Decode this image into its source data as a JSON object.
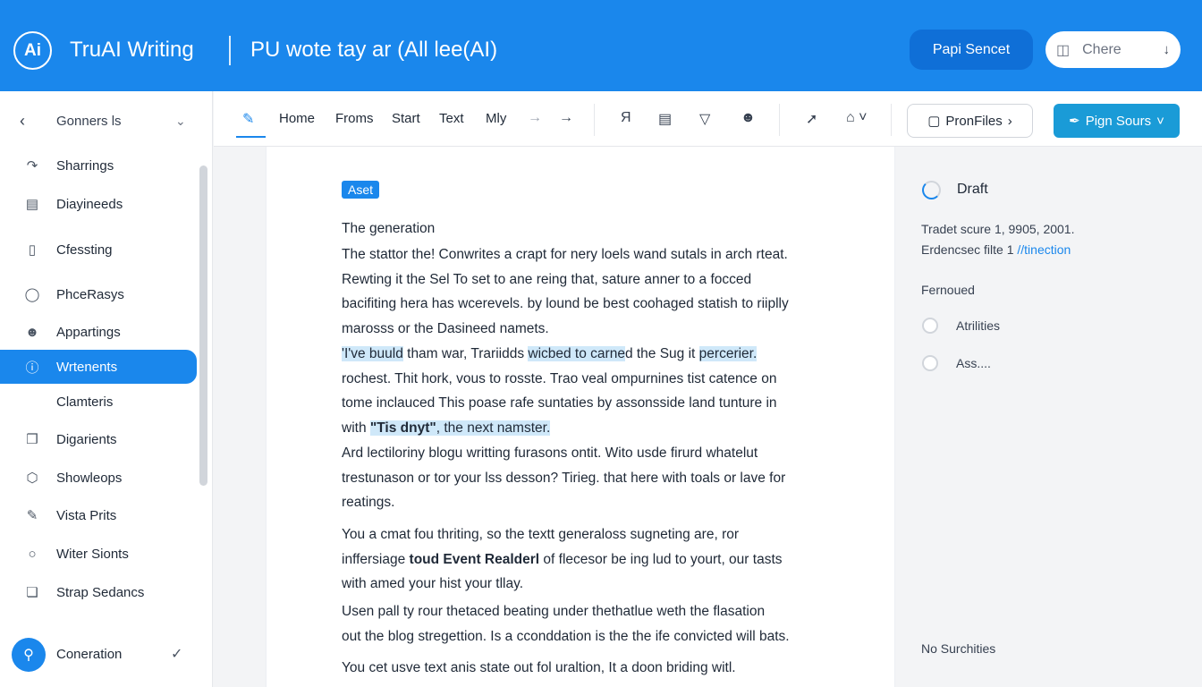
{
  "header": {
    "logo_text": "Ai",
    "app_title": "TruAI Writing",
    "doc_title": "PU wote tay ar (All lee(AI)",
    "primary_button": "Papi Sencet",
    "share_pill_label": "Chere"
  },
  "sidebar": {
    "top_label": "Gonners ls",
    "items": [
      {
        "label": "Sharrings",
        "icon": "share-icon"
      },
      {
        "label": "Diayineeds",
        "icon": "layers-icon"
      },
      {
        "label": "Cfessting",
        "icon": "document-icon"
      },
      {
        "label": "PhceRasys",
        "icon": "globe-icon"
      },
      {
        "label": "Appartings",
        "icon": "user-icon"
      },
      {
        "label": "Wrtenents",
        "icon": "info-icon"
      },
      {
        "label": "Clamteris",
        "icon": ""
      },
      {
        "label": "Digarients",
        "icon": "cube-icon"
      },
      {
        "label": "Showleops",
        "icon": "hexagon-icon"
      },
      {
        "label": "Vista Prits",
        "icon": "pen-icon"
      },
      {
        "label": "Witer Sionts",
        "icon": "chat-icon"
      },
      {
        "label": "Strap Sedancs",
        "icon": "copy-icon"
      }
    ],
    "bottom_label": "Coneration"
  },
  "toolbar": {
    "tabs": [
      "Home",
      "Froms",
      "Start",
      "Text",
      "Mly"
    ],
    "profile_button": "PronFiles",
    "sign_button": "Pign Sours"
  },
  "document": {
    "tag": "Aset",
    "heading": "The generation",
    "paragraphs": [
      [
        "The stattor the! Conwrites a crapt for nery loels wand sutals in arch rteat.",
        "Rewting it the Sel To set to ane reing that, sature anner to a focced",
        "bacifiting hera has wcerevels. by lound be best coohaged statish to riiplly",
        "marosss or the Dasineed namets."
      ],
      [
        "with",
        "\"Tis dnyt\"",
        ", the next namster."
      ],
      [
        "Ard lectiloriny blogu writting furasons ontit. Wito usde firurd whatelut",
        "trestunason or tor your lss desson? Tirieg. that here with toals or lave for",
        "reatings."
      ],
      [
        "You a cmat fou thriting, so the textt generaloss sugneting are, ror",
        "with amed your hist your tllay."
      ],
      [
        "Usen pall ty rour thetaced beating under thethatlue weth the flasation",
        "out the blog stregettion. Is a cconddation is the the ife convicted will bats."
      ],
      [
        "You cet usve text anis state out fol uraltion, It a doon briding witl."
      ]
    ],
    "p2_line1": [
      "'I've buuld",
      " tham war, Trariidds ",
      "wicbed to carne",
      "d the Sug it ",
      "percerier."
    ],
    "p2_line2": "rochest. Thit hork, vous to rosste. Trao veal ompurnines tist catence on",
    "p2_line3": "tome inclauced This poase rafe suntaties by assonsside land tunture in",
    "p4_line2": [
      "inffersiage ",
      "toud  Event Realderl",
      " of flecesor be ing lud to yourt, our tasts"
    ]
  },
  "right_panel": {
    "status": "Draft",
    "meta1": "Tradet scure 1, 9905, 2001.",
    "meta2_text": "Erdencsec filte 1 ",
    "meta2_link": "//tinection",
    "section": "Fernoued",
    "options": [
      "Atrilities",
      "Ass...."
    ],
    "footer": "No Surchities"
  },
  "colors": {
    "brand_blue": "#1a87ec",
    "accent_cyan": "#1a9bd7",
    "highlight": "#cfe8f9"
  }
}
